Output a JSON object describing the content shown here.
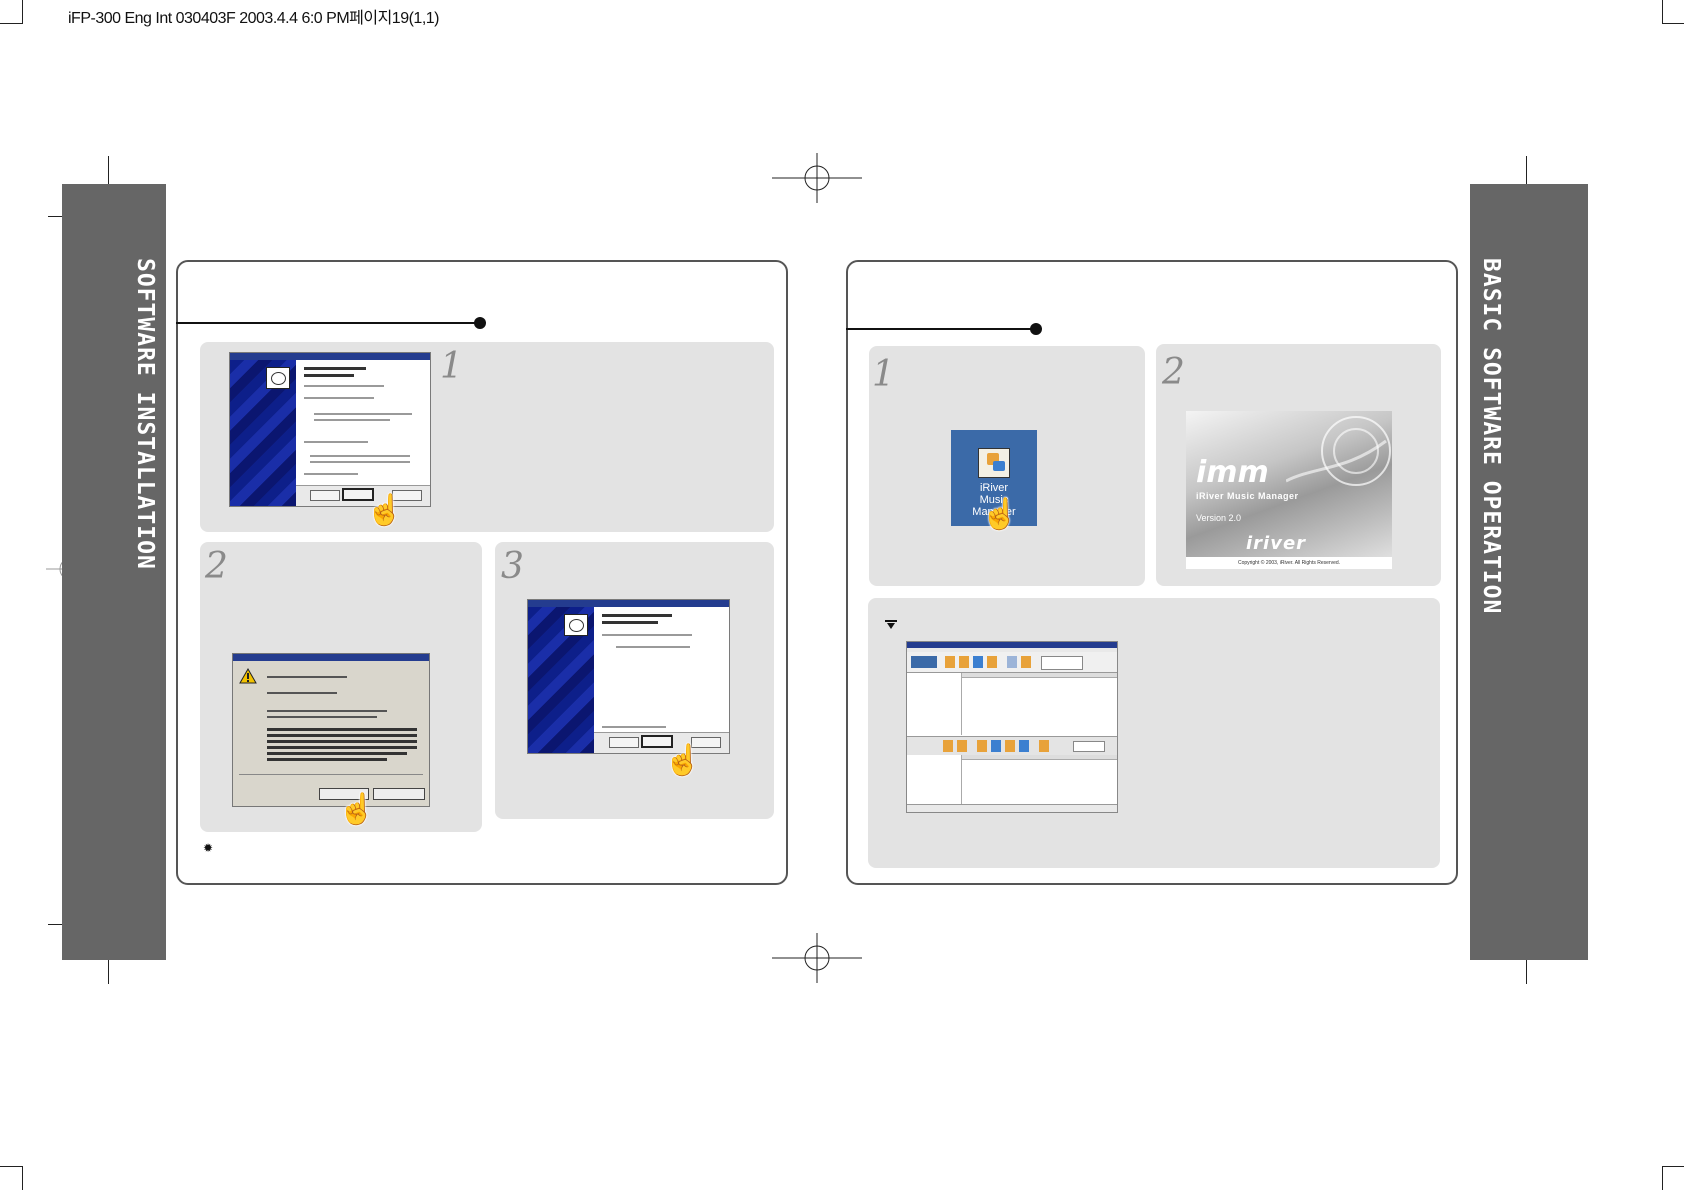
{
  "header": {
    "slug": "iFP-300 Eng Int 030403F  2003.4.4 6:0 PM페이지19(1,1)"
  },
  "left_page": {
    "side_title": "SOFTWARE INSTALLATION",
    "steps": [
      {
        "number": "1"
      },
      {
        "number": "2"
      },
      {
        "number": "3"
      }
    ],
    "note_icon": "bullet-sun-icon"
  },
  "right_page": {
    "side_title": "BASIC SOFTWARE OPERATION",
    "steps": [
      {
        "number": "1"
      },
      {
        "number": "2"
      }
    ],
    "desktop_icon": {
      "label_line1": "iRiver",
      "label_line2": "Music",
      "label_line3": "Manager"
    },
    "splash": {
      "logo": "imm",
      "product": "iRiver Music Manager",
      "version": "Version 2.0",
      "brand": "iriver",
      "copyright": "Copyright © 2003, iRiver. All Rights Reserved."
    },
    "note_icon": "triangle-down-icon"
  },
  "colors": {
    "side_tab": "#666666",
    "panel": "#e3e3e3",
    "frame_border": "#555555"
  }
}
